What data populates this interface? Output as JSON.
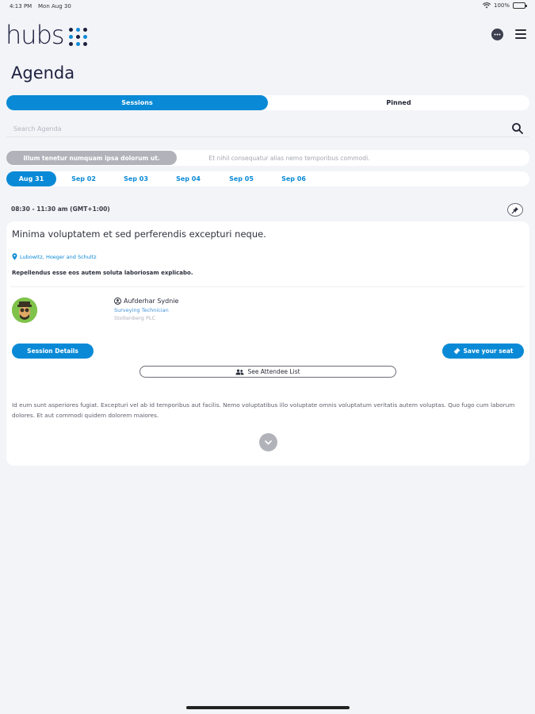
{
  "status_bar": {
    "time": "4:13 PM",
    "date": "Mon Aug 30",
    "battery": "100%",
    "battery_level": 1.0
  },
  "header": {
    "logo_text": "hubs",
    "logo_dot_colors": [
      "#1c1f3d",
      "#0a8ad6",
      "#1c1f3d",
      "#0a8ad6",
      "#1c1f3d",
      "#0a8ad6",
      "#1c1f3d",
      "#0a8ad6",
      "#1c1f3d"
    ],
    "chat_icon": "chat-bubble-icon",
    "menu_icon": "hamburger-menu-icon"
  },
  "page_title": "Agenda",
  "tabs": [
    {
      "label": "Sessions",
      "active": true
    },
    {
      "label": "Pinned",
      "active": false
    }
  ],
  "search": {
    "placeholder": "Search Agenda",
    "value": "",
    "icon": "search-icon"
  },
  "filters": [
    {
      "label": "Illum tenetur numquam ipsa dolorum ut.",
      "active": true
    },
    {
      "label": "Et nihil consequatur alias nemo temporibus commodi.",
      "active": false
    }
  ],
  "dates": [
    {
      "label": "Aug 31",
      "active": true
    },
    {
      "label": "Sep 02",
      "active": false
    },
    {
      "label": "Sep 03",
      "active": false
    },
    {
      "label": "Sep 04",
      "active": false
    },
    {
      "label": "Sep 05",
      "active": false
    },
    {
      "label": "Sep 06",
      "active": false
    }
  ],
  "session": {
    "time": "08:30 - 11:30 am (GMT+1:00)",
    "title": "Minima voluptatem et sed perferendis excepturi neque.",
    "location": "Lubowitz, Hoeger and Schultz",
    "subtitle": "Repellendus esse eos autem soluta laboriosam explicabo.",
    "speaker": {
      "name": "Aufderhar Sydnie",
      "role": "Surveying Technician",
      "company": "Stoltenberg PLC"
    },
    "details_label": "Session Details",
    "seat_label": "Save your seat",
    "attendees_label": "See Attendee List",
    "description": "Id eum sunt asperiores fugiat. Excepturi vel ab id temporibus aut facilis. Nemo voluptatibus illo voluptate omnis voluptatum veritatis autem voluptas. Quo fugo cum laborum dolores. Et aut commodi quidem dolorem maiores.",
    "colors": {
      "accent": "#0a8ad6",
      "muted": "#b2b3ba"
    }
  }
}
